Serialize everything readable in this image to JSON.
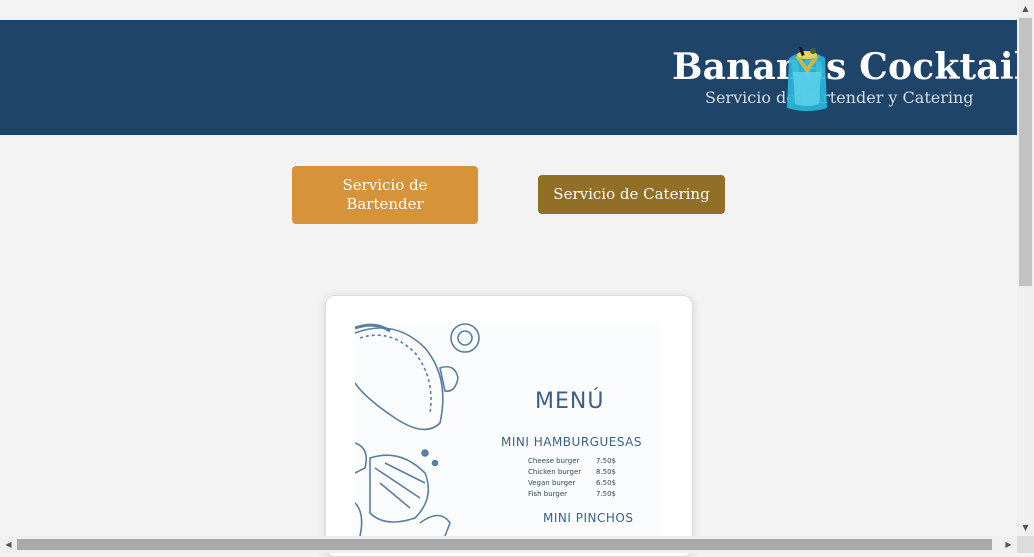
{
  "header": {
    "title": "Bananas Cocktails",
    "subtitle": "Servicio de Bartender y Catering",
    "logo_icon": "cocktail-glass-logo",
    "bg_color": "#1f446a"
  },
  "services": {
    "bartender_label": "Servicio de Bartender",
    "catering_label": "Servicio de Catering",
    "bartender_color": "#d6933a",
    "catering_color": "#926f26"
  },
  "menu_card": {
    "title": "MENÚ",
    "sections": [
      {
        "name": "MINI HAMBURGUESAS",
        "items": [
          {
            "name": "Cheese burger",
            "price": "7.50$"
          },
          {
            "name": "Chicken burger",
            "price": "8.50$"
          },
          {
            "name": "Vegan burger",
            "price": "6.50$"
          },
          {
            "name": "Fish burger",
            "price": "7.50$"
          }
        ]
      },
      {
        "name": "MINI PINCHOS",
        "items": []
      }
    ]
  },
  "scrollbars": {
    "up_arrow": "▲",
    "down_arrow": "▼",
    "left_arrow": "◀",
    "right_arrow": "▶"
  }
}
